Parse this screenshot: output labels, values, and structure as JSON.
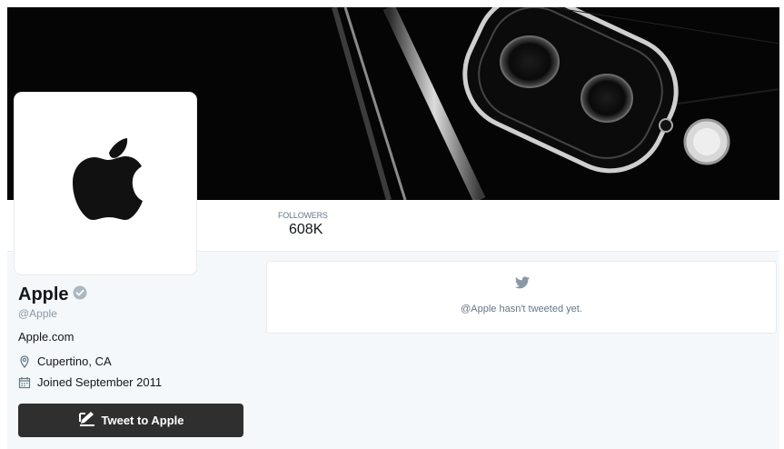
{
  "stats": {
    "followers_label": "FOLLOWERS",
    "followers_value": "608K"
  },
  "profile": {
    "name": "Apple",
    "handle": "@Apple",
    "url": "Apple.com",
    "location": "Cupertino, CA",
    "joined": "Joined September 2011",
    "verified": true
  },
  "actions": {
    "tweet_to_label": "Tweet to Apple"
  },
  "timeline": {
    "empty_message": "@Apple hasn't tweeted yet."
  },
  "icons": {
    "verified": "verified-badge-icon",
    "location": "map-pin-icon",
    "joined": "calendar-icon",
    "compose": "compose-icon",
    "bird": "twitter-bird-icon"
  },
  "colors": {
    "header_background": "#050505",
    "button_background": "#2f2f2f",
    "page_background": "#f5f8fa",
    "muted_text": "#657786"
  }
}
